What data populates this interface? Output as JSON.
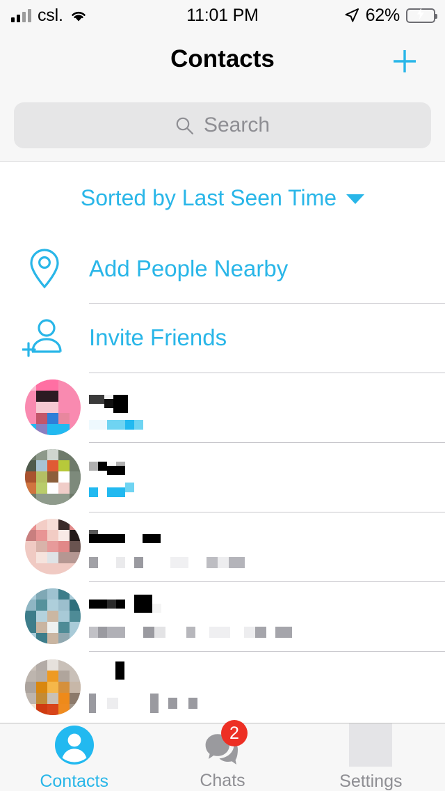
{
  "statusbar": {
    "carrier": "csl.",
    "time": "11:01 PM",
    "battery_percent": "62%",
    "signal_bars_filled": 2,
    "wifi_icon": "wifi-icon",
    "location_icon": "location-arrow-icon",
    "battery_icon": "battery-charging-icon",
    "battery_fill_ratio": 0.62,
    "battery_color": "#4cd964"
  },
  "header": {
    "title": "Contacts",
    "add_icon": "plus-icon",
    "accent_color": "#29b6e8",
    "background": "#f7f7f7"
  },
  "search": {
    "placeholder": "Search",
    "value": "",
    "icon": "search-icon",
    "background": "#e6e6e7"
  },
  "sort": {
    "label": "Sorted by Last Seen Time",
    "chevron_icon": "chevron-down-icon"
  },
  "actions": [
    {
      "label": "Add People Nearby",
      "icon": "location-pin-icon",
      "name": "add-people-nearby"
    },
    {
      "label": "Invite Friends",
      "icon": "person-add-icon",
      "name": "invite-friends"
    }
  ],
  "contacts": [
    {
      "name_redacted": true,
      "status_kind": "online",
      "status_color": "#29b6e8",
      "avatar_colors": [
        "#f98ab0",
        "#ff6fa3",
        "#2b1b22",
        "#f6c9d2",
        "#2f7ed8",
        "#22b9f0",
        "#c2566a"
      ]
    },
    {
      "name_redacted": true,
      "status_kind": "online",
      "status_color": "#29b6e8",
      "avatar_colors": [
        "#6e7a6a",
        "#9aa79a",
        "#cfd6cf",
        "#e05a34",
        "#b7c93a",
        "#8c5f3b",
        "#ffffff"
      ]
    },
    {
      "name_redacted": true,
      "status_kind": "offline",
      "status_color": "#a1a1a6",
      "avatar_colors": [
        "#e89090",
        "#f3cdc6",
        "#e7b7ae",
        "#3a2b2a",
        "#f7e6e2",
        "#b59792",
        "#d97f7f"
      ]
    },
    {
      "name_redacted": true,
      "status_kind": "offline",
      "status_color": "#a1a1a6",
      "avatar_colors": [
        "#7fa8b5",
        "#a9cbd8",
        "#3d7d8a",
        "#cbb7a2",
        "#eef1f0",
        "#56929c",
        "#90a8b0"
      ]
    },
    {
      "name_redacted": true,
      "status_kind": "offline",
      "status_color": "#a1a1a6",
      "avatar_colors": [
        "#b3aba6",
        "#ee9a22",
        "#f5b74a",
        "#cf3b10",
        "#d8d2cd",
        "#8c7a6b",
        "#f1e3d2"
      ]
    }
  ],
  "tabbar": {
    "items": [
      {
        "label": "Contacts",
        "icon": "person-circle-icon",
        "active": true,
        "badge": ""
      },
      {
        "label": "Chats",
        "icon": "chat-bubbles-icon",
        "active": false,
        "badge": "2"
      },
      {
        "label": "Settings",
        "icon": "settings-placeholder-icon",
        "active": false,
        "badge": ""
      }
    ],
    "badge_color": "#ed2f24",
    "active_color": "#29b6e8",
    "inactive_color": "#8e8e93"
  }
}
